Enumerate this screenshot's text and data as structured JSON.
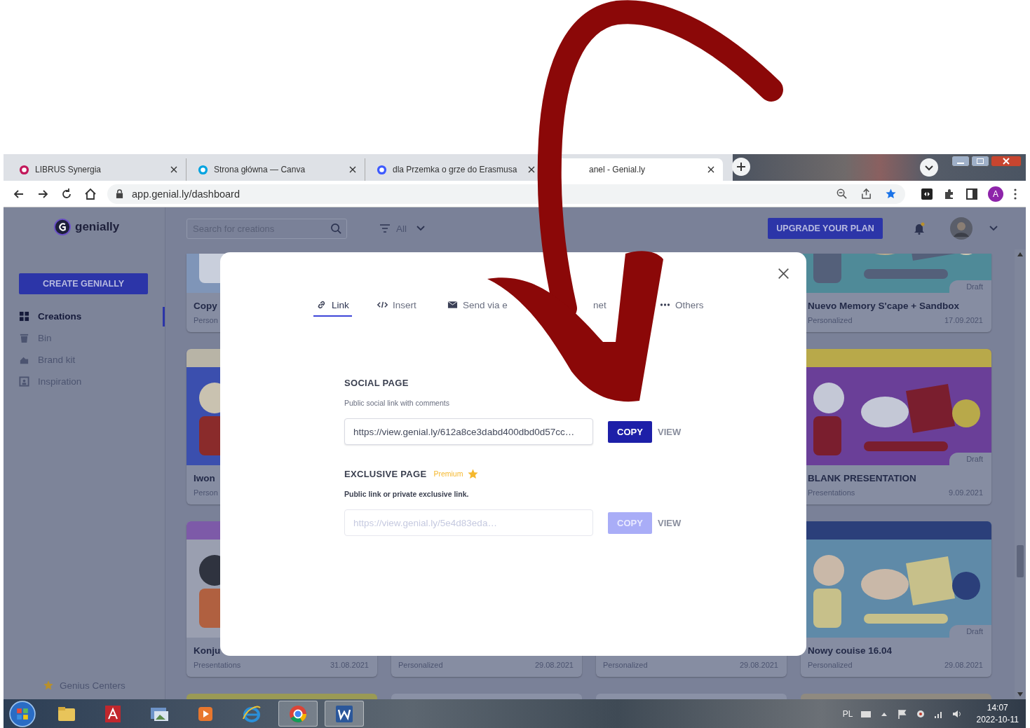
{
  "browser": {
    "tabs": [
      {
        "title": "LIBRUS Synergia",
        "selected": false
      },
      {
        "title": "Strona główna — Canva",
        "selected": false
      },
      {
        "title": "dla Przemka o grze do Erasmusa",
        "selected": false
      },
      {
        "title": "anel - Genial.ly",
        "selected": true
      }
    ],
    "url": "app.genial.ly/dashboard",
    "profile": "A"
  },
  "app": {
    "logo": "genially",
    "search": {
      "placeholder": "Search for creations"
    },
    "filter": "All",
    "upgrade": "UPGRADE YOUR PLAN",
    "create": "CREATE GENIALLY",
    "nav": [
      {
        "label": "Creations",
        "selected": true
      },
      {
        "label": "Bin",
        "selected": false
      },
      {
        "label": "Brand kit",
        "selected": false
      },
      {
        "label": "Inspiration",
        "selected": false
      }
    ],
    "footer_link": "Genius Centers"
  },
  "cards": [
    {
      "kind": "picture",
      "title": "Copy",
      "type": "Person"
    },
    {
      "kind": "picture",
      "badge": "Draft",
      "title": "Nuevo Memory S'cape + Sandbox",
      "type": "Personalized",
      "date": "17.09.2021"
    },
    {
      "kind": "picture",
      "title": "Iwon",
      "type": "Person"
    },
    {
      "kind": "picture",
      "badge": "Draft",
      "title": "BLANK PRESENTATION",
      "type": "Presentations",
      "date": "9.09.2021"
    },
    {
      "kind": "picture",
      "title": "Konju",
      "type": "Presentations",
      "date": "31.08.2021"
    },
    {
      "type": "Personalized",
      "date": "29.08.2021"
    },
    {
      "type": "Personalized",
      "date": "29.08.2021"
    },
    {
      "kind": "picture",
      "badge": "Draft",
      "title": "Nowy couise 16.04",
      "type": "Personalized",
      "date": "29.08.2021"
    }
  ],
  "modal": {
    "tabs": [
      {
        "label": "Link",
        "selected": true
      },
      {
        "label": "Insert",
        "selected": false
      },
      {
        "label": "Send via e",
        "selected": false
      },
      {
        "label": "net",
        "selected": false
      },
      {
        "label": "Others",
        "selected": false
      }
    ],
    "sections": [
      {
        "title": "SOCIAL PAGE",
        "subtitle": "Public social link with comments",
        "subtitle_bold": false,
        "field": {
          "value": "https://view.genial.ly/612a8ce3dabd400dbd0d57cc…",
          "disabled": false
        },
        "copy": {
          "label": "COPY",
          "disabled": false
        },
        "view": "VIEW"
      },
      {
        "title": "EXCLUSIVE PAGE",
        "badge": "Premium",
        "subtitle": "Public link or private exclusive link.",
        "subtitle_bold": true,
        "field": {
          "value": "https://view.genial.ly/5e4d83eda…",
          "disabled": true
        },
        "copy": {
          "label": "COPY",
          "disabled": true
        },
        "view": "VIEW"
      }
    ]
  },
  "taskbar": {
    "apps": [
      {
        "kind": "folder",
        "selected": false
      },
      {
        "kind": "pdf",
        "selected": false
      },
      {
        "kind": "photos",
        "selected": false
      },
      {
        "kind": "media",
        "selected": false
      },
      {
        "kind": "ie",
        "selected": false
      },
      {
        "kind": "chrome",
        "selected": true
      },
      {
        "kind": "word",
        "selected": true
      }
    ],
    "language": "PL",
    "time": "14:07",
    "date": "2022-10-11"
  }
}
